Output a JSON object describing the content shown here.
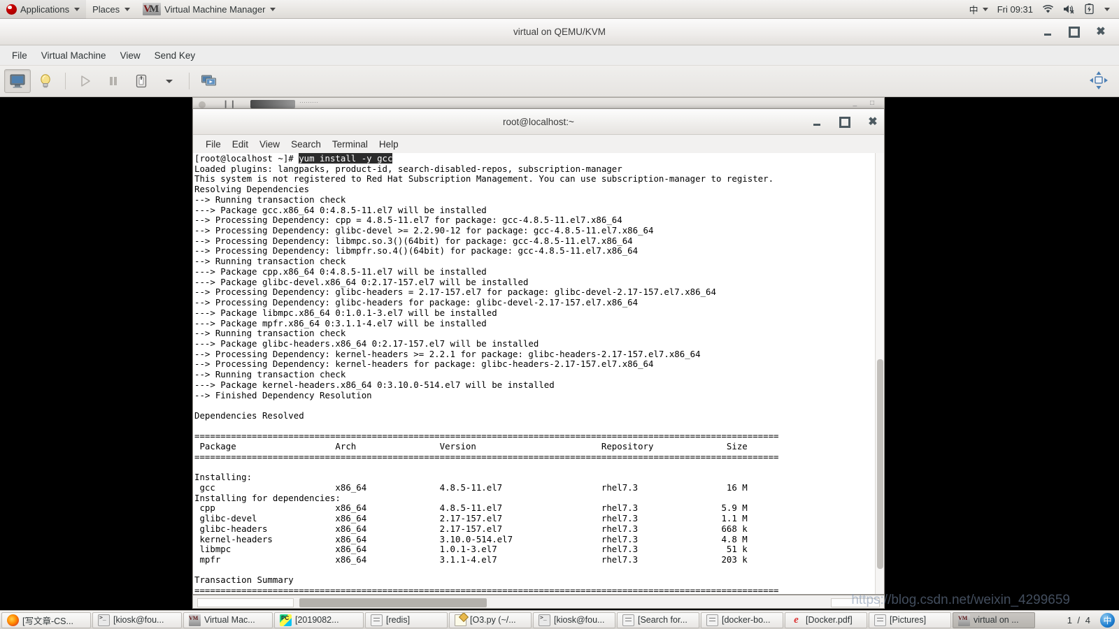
{
  "gnome_panel": {
    "applications": "Applications",
    "places": "Places",
    "app_title": "Virtual Machine Manager",
    "ime": "中",
    "clock": "Fri 09:31",
    "icons": [
      "wifi-icon",
      "volume-muted-icon",
      "battery-icon",
      "caret-down-icon"
    ]
  },
  "vmm_window": {
    "title": "virtual on QEMU/KVM",
    "menu": [
      "File",
      "Virtual Machine",
      "View",
      "Send Key"
    ],
    "toolbar": [
      {
        "name": "show-graphical-console",
        "icon": "monitor-icon",
        "active": true
      },
      {
        "name": "show-virtual-hardware-details",
        "icon": "lightbulb-icon",
        "active": false
      },
      {
        "name": "run-vm",
        "icon": "play-icon",
        "active": false
      },
      {
        "name": "pause-vm",
        "icon": "pause-icon",
        "active": false
      },
      {
        "name": "shutdown-vm",
        "icon": "power-icon",
        "active": false
      },
      {
        "name": "shutdown-options",
        "icon": "caret-down-icon",
        "active": false
      },
      {
        "name": "take-snapshot",
        "icon": "snapshot-icon",
        "active": false
      }
    ],
    "fullscreen_icon": "fullscreen-icon",
    "window_controls": [
      "minimize",
      "maximize",
      "close"
    ]
  },
  "terminal": {
    "title": "root@localhost:~",
    "menu": [
      "File",
      "Edit",
      "View",
      "Search",
      "Terminal",
      "Help"
    ],
    "window_controls": [
      "minimize",
      "maximize",
      "close"
    ],
    "prompt": "[root@localhost ~]# ",
    "command": "yum install -y gcc",
    "output": "Loaded plugins: langpacks, product-id, search-disabled-repos, subscription-manager\nThis system is not registered to Red Hat Subscription Management. You can use subscription-manager to register.\nResolving Dependencies\n--> Running transaction check\n---> Package gcc.x86_64 0:4.8.5-11.el7 will be installed\n--> Processing Dependency: cpp = 4.8.5-11.el7 for package: gcc-4.8.5-11.el7.x86_64\n--> Processing Dependency: glibc-devel >= 2.2.90-12 for package: gcc-4.8.5-11.el7.x86_64\n--> Processing Dependency: libmpc.so.3()(64bit) for package: gcc-4.8.5-11.el7.x86_64\n--> Processing Dependency: libmpfr.so.4()(64bit) for package: gcc-4.8.5-11.el7.x86_64\n--> Running transaction check\n---> Package cpp.x86_64 0:4.8.5-11.el7 will be installed\n---> Package glibc-devel.x86_64 0:2.17-157.el7 will be installed\n--> Processing Dependency: glibc-headers = 2.17-157.el7 for package: glibc-devel-2.17-157.el7.x86_64\n--> Processing Dependency: glibc-headers for package: glibc-devel-2.17-157.el7.x86_64\n---> Package libmpc.x86_64 0:1.0.1-3.el7 will be installed\n---> Package mpfr.x86_64 0:3.1.1-4.el7 will be installed\n--> Running transaction check\n---> Package glibc-headers.x86_64 0:2.17-157.el7 will be installed\n--> Processing Dependency: kernel-headers >= 2.2.1 for package: glibc-headers-2.17-157.el7.x86_64\n--> Processing Dependency: kernel-headers for package: glibc-headers-2.17-157.el7.x86_64\n--> Running transaction check\n---> Package kernel-headers.x86_64 0:3.10.0-514.el7 will be installed\n--> Finished Dependency Resolution\n\nDependencies Resolved\n\n================================================================================================================\n Package                   Arch                Version                        Repository              Size\n================================================================================================================\n\nInstalling:\n gcc                       x86_64              4.8.5-11.el7                   rhel7.3                 16 M\nInstalling for dependencies:\n cpp                       x86_64              4.8.5-11.el7                   rhel7.3                5.9 M\n glibc-devel               x86_64              2.17-157.el7                   rhel7.3                1.1 M\n glibc-headers             x86_64              2.17-157.el7                   rhel7.3                668 k\n kernel-headers            x86_64              3.10.0-514.el7                 rhel7.3                4.8 M\n libmpc                    x86_64              1.0.1-3.el7                    rhel7.3                 51 k\n mpfr                      x86_64              3.1.1-4.el7                    rhel7.3                203 k\n\nTransaction Summary\n================================================================================================================",
    "table": {
      "headers": [
        "Package",
        "Arch",
        "Version",
        "Repository",
        "Size"
      ],
      "groups": [
        {
          "label": "Installing:",
          "rows": [
            {
              "package": "gcc",
              "arch": "x86_64",
              "version": "4.8.5-11.el7",
              "repository": "rhel7.3",
              "size": "16 M"
            }
          ]
        },
        {
          "label": "Installing for dependencies:",
          "rows": [
            {
              "package": "cpp",
              "arch": "x86_64",
              "version": "4.8.5-11.el7",
              "repository": "rhel7.3",
              "size": "5.9 M"
            },
            {
              "package": "glibc-devel",
              "arch": "x86_64",
              "version": "2.17-157.el7",
              "repository": "rhel7.3",
              "size": "1.1 M"
            },
            {
              "package": "glibc-headers",
              "arch": "x86_64",
              "version": "2.17-157.el7",
              "repository": "rhel7.3",
              "size": "668 k"
            },
            {
              "package": "kernel-headers",
              "arch": "x86_64",
              "version": "3.10.0-514.el7",
              "repository": "rhel7.3",
              "size": "4.8 M"
            },
            {
              "package": "libmpc",
              "arch": "x86_64",
              "version": "1.0.1-3.el7",
              "repository": "rhel7.3",
              "size": "51 k"
            },
            {
              "package": "mpfr",
              "arch": "x86_64",
              "version": "3.1.1-4.el7",
              "repository": "rhel7.3",
              "size": "203 k"
            }
          ]
        }
      ],
      "summary_label": "Transaction Summary"
    }
  },
  "taskbar": {
    "items": [
      {
        "label": "[写文章-CS...",
        "icon": "firefox-icon",
        "icon_class": "ico-ff",
        "width": "w-a",
        "active": false
      },
      {
        "label": "[kiosk@fou...",
        "icon": "terminal-icon",
        "icon_class": "ico-term",
        "width": "w-a",
        "active": false
      },
      {
        "label": "Virtual Mac...",
        "icon": "vmm-icon",
        "icon_class": "ico-vmm",
        "width": "w-a",
        "active": false
      },
      {
        "label": "[2019082...",
        "icon": "pycharm-icon",
        "icon_class": "ico-pc",
        "width": "w-a",
        "active": false
      },
      {
        "label": "[redis]",
        "icon": "file-manager-icon",
        "icon_class": "ico-file",
        "width": "w-b",
        "active": false
      },
      {
        "label": "[O3.py (~/...",
        "icon": "text-editor-icon",
        "icon_class": "ico-note",
        "width": "w-b",
        "active": false
      },
      {
        "label": "[kiosk@fou...",
        "icon": "terminal-icon",
        "icon_class": "ico-term",
        "width": "w-b",
        "active": false
      },
      {
        "label": "[Search for...",
        "icon": "file-manager-icon",
        "icon_class": "ico-file",
        "width": "w-b",
        "active": false
      },
      {
        "label": "[docker-bo...",
        "icon": "file-manager-icon",
        "icon_class": "ico-file",
        "width": "w-b",
        "active": false
      },
      {
        "label": "[Docker.pdf]",
        "icon": "pdf-icon",
        "icon_class": "ico-pdf",
        "width": "w-b",
        "active": false
      },
      {
        "label": "[Pictures]",
        "icon": "file-manager-icon",
        "icon_class": "ico-file",
        "width": "w-b",
        "active": false
      },
      {
        "label": "virtual on ...",
        "icon": "vmm-icon",
        "icon_class": "ico-vmm",
        "width": "w-b",
        "active": true
      }
    ],
    "workspace_count": "1 / 4",
    "ime_badge": "中"
  },
  "watermark": {
    "line1": "https://blog.csdn.net/weixin_4299659"
  }
}
